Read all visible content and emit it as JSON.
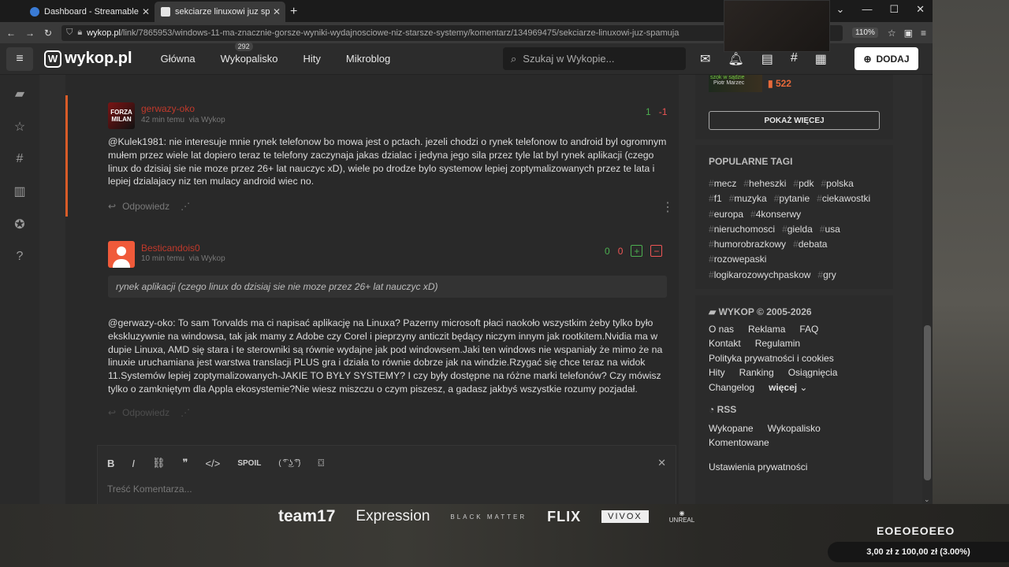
{
  "browser": {
    "tabs": [
      {
        "label": "Dashboard - Streamable",
        "active": false
      },
      {
        "label": "sekciarze linuxowi juz spamuja",
        "active": true
      }
    ],
    "url_host": "wykop.pl",
    "url_path": "/link/7865953/windows-11-ma-znacznie-gorsze-wyniki-wydajnosciowe-niz-starsze-systemy/komentarz/134969475/sekciarze-linuxowi-juz-spamuja",
    "zoom": "110%"
  },
  "header": {
    "logo": "wykop.pl",
    "nav": [
      "Główna",
      "Wykopalisko",
      "Hity",
      "Mikroblog"
    ],
    "wykopalisko_count": "292",
    "search_placeholder": "Szukaj w Wykopie...",
    "add_label": "DODAJ"
  },
  "comments": [
    {
      "author": "gerwazy-oko",
      "time": "42 min temu",
      "via": "via Wykop",
      "avatar_text": "FORZA MILAN",
      "votes_plus": "1",
      "votes_minus": "-1",
      "mention": "@Kulek1981",
      "body": ": nie interesuje mnie rynek telefonow bo mowa jest o pctach. jezeli chodzi o rynek telefonow to android byl ogromnym mułem przez wiele lat dopiero teraz te telefony zaczynaja jakas dzialac i jedyna jego sila przez tyle lat byl rynek aplikacji (czego linux do dzisiaj sie nie moze przez 26+ lat nauczyc xD), wiele po drodze bylo systemow lepiej zoptymalizowanych przez te lata i lepiej dzialajacy niz ten mulacy android wiec no.",
      "reply": "Odpowiedz"
    },
    {
      "author": "Besticandois0",
      "time": "10 min temu",
      "via": "via Wykop",
      "votes_plus": "0",
      "votes_minus": "0",
      "quote": "rynek aplikacji (czego linux do dzisiaj sie nie moze przez 26+ lat nauczyc xD)",
      "mention": "@gerwazy-oko",
      "body": ": To sam Torvalds ma ci napisać aplikację na Linuxa? Pazerny microsoft płaci naokoło wszystkim żeby tylko było ekskluzywnie na windowsa, tak jak mamy z Adobe czy Corel i pieprzyny anticzit będący niczym innym jak rootkitem.Nvidia ma w dupie Linuxa, AMD się stara i te sterowniki są równie wydajne jak pod windowsem.Jaki ten windows nie wspaniały że mimo że na linuxie uruchamiana jest warstwa translacji PLUS gra i działa to równie dobrze jak na windzie.Rzygać się chce teraz na widok 11.Systemów lepiej zoptymalizowanych-JAKIE TO BYŁY SYSTEMY? I czy były dostępne na różne marki telefonów? Czy mówisz tylko o zamkniętym dla Appla ekosystemie?Nie wiesz miszczu o czym piszesz, a gadasz jakbyś wszystkie rozumy pozjadał.",
      "reply": "Odpowiedz"
    }
  ],
  "editor": {
    "spoil": "SPOIL",
    "lenny": "( ͡° ͜ʖ ͡°)",
    "placeholder": "Treść Komentarza..."
  },
  "right": {
    "promo_caption": "szok w sądzie",
    "promo_name": "Piotr Marzec",
    "promo_count": "522",
    "show_more": "POKAŻ WIĘCEJ",
    "tags_title": "POPULARNE TAGI",
    "tags": [
      "mecz",
      "heheszki",
      "pdk",
      "polska",
      "f1",
      "muzyka",
      "pytanie",
      "ciekawostki",
      "europa",
      "4konserwy",
      "nieruchomosci",
      "gielda",
      "usa",
      "humorobrazkowy",
      "debata",
      "rozowepaski",
      "logikarozowychpaskow",
      "gry"
    ],
    "footer_title": "WYKOP © 2005-2026",
    "links": [
      "O nas",
      "Reklama",
      "FAQ",
      "Kontakt",
      "Regulamin",
      "Polityka prywatności i cookies",
      "Hity",
      "Ranking",
      "Osiągnięcia",
      "Changelog",
      "więcej"
    ],
    "rss_title": "RSS",
    "rss_links": [
      "Wykopane",
      "Wykopalisko",
      "Komentowane"
    ],
    "privacy": "Ustawienia prywatności"
  },
  "stream": {
    "sponsors": [
      "team17",
      "Expression",
      "BLACK MATTER",
      "FLIX",
      "VIVOX",
      "UNREAL"
    ],
    "ticker": "EOEOEOEEO",
    "donation": "3,00 zł z 100,00 zł (3.00%)"
  },
  "colors": {
    "accent": "#d95c28",
    "author": "#c0392b",
    "plus": "#4caf50",
    "minus": "#ee5555"
  }
}
